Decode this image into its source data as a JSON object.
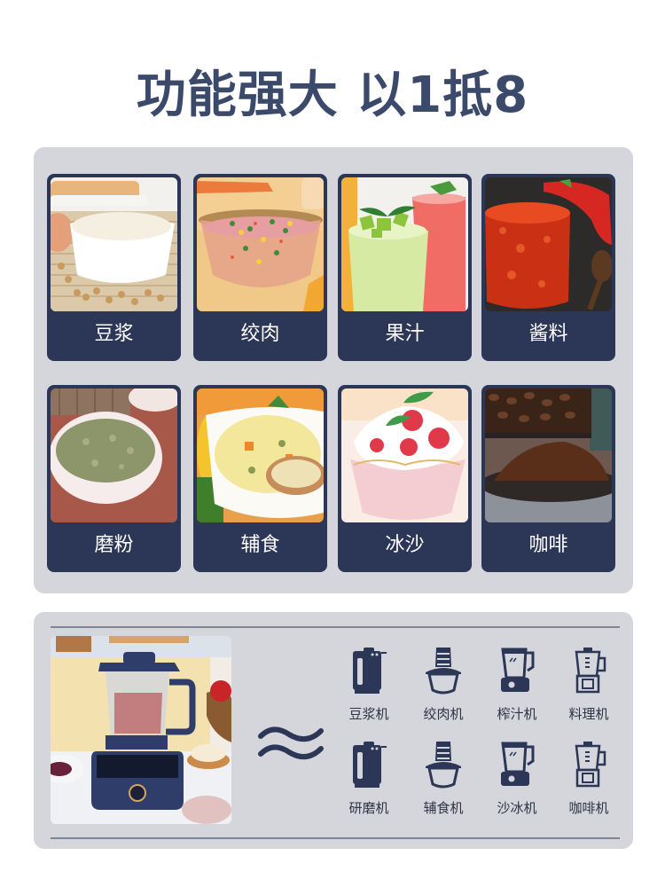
{
  "title": "功能强大 以1抵8",
  "functions": [
    {
      "label": "豆浆",
      "image": "soy-milk-photo"
    },
    {
      "label": "绞肉",
      "image": "minced-meat-photo"
    },
    {
      "label": "果汁",
      "image": "juice-photo"
    },
    {
      "label": "酱料",
      "image": "sauce-photo"
    },
    {
      "label": "磨粉",
      "image": "grinding-powder-photo"
    },
    {
      "label": "辅食",
      "image": "baby-food-photo"
    },
    {
      "label": "冰沙",
      "image": "smoothie-photo"
    },
    {
      "label": "咖啡",
      "image": "coffee-photo"
    }
  ],
  "comparison": {
    "product_image": "blender-product-photo",
    "symbol": "≈",
    "appliances": [
      {
        "label": "豆浆机",
        "icon": "soymilk-maker-icon"
      },
      {
        "label": "绞肉机",
        "icon": "meat-grinder-icon"
      },
      {
        "label": "榨汁机",
        "icon": "juicer-icon"
      },
      {
        "label": "料理机",
        "icon": "food-processor-icon"
      },
      {
        "label": "研磨机",
        "icon": "soymilk-maker-icon"
      },
      {
        "label": "辅食机",
        "icon": "meat-grinder-icon"
      },
      {
        "label": "沙冰机",
        "icon": "juicer-icon"
      },
      {
        "label": "咖啡机",
        "icon": "food-processor-icon"
      }
    ]
  },
  "colors": {
    "title": "#3b4a6b",
    "panel_bg": "#d4d6db",
    "card_bg": "#2c3656",
    "icon": "#2c3656"
  }
}
